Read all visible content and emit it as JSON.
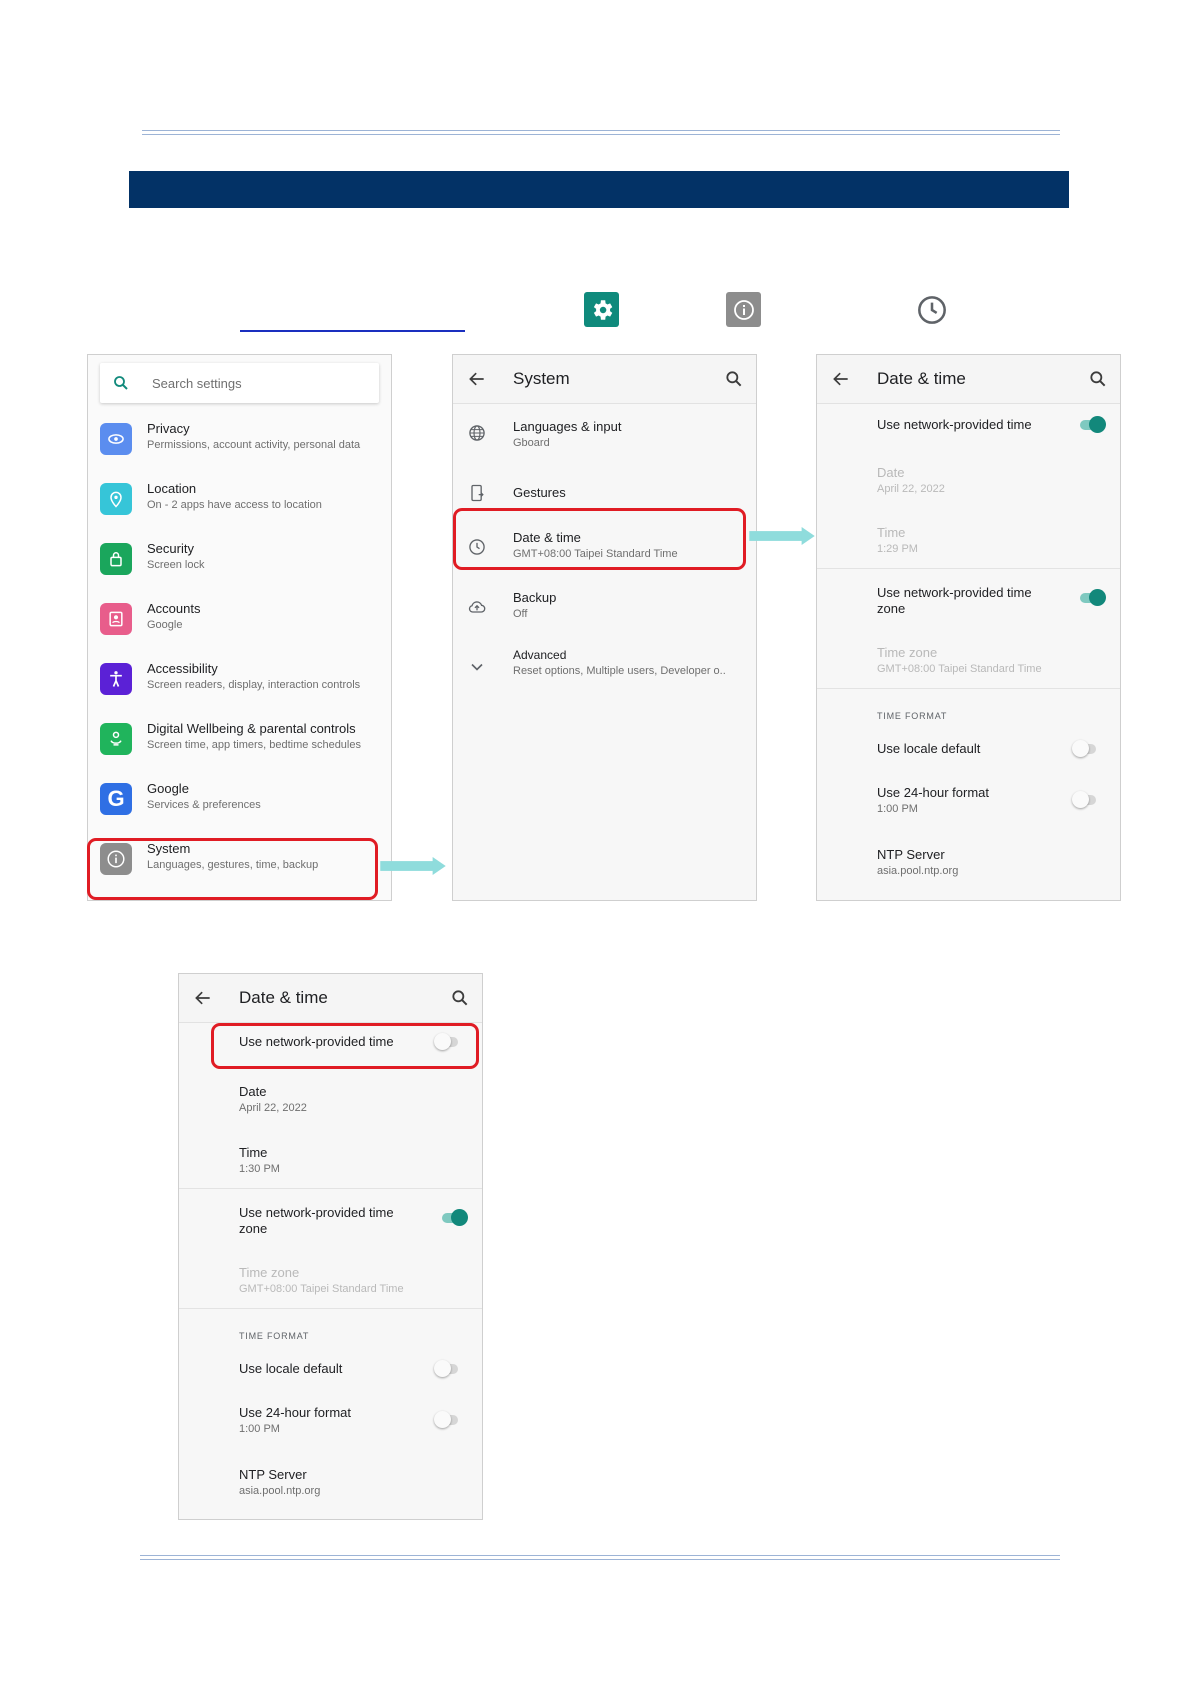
{
  "doc": {
    "banner_color": "#033266",
    "highlight_color": "#e01c24",
    "arrow_color": "#8fdcdc"
  },
  "top_icons": [
    "settings-gear-icon",
    "system-info-icon",
    "clock-icon"
  ],
  "panel1": {
    "search_placeholder": "Search settings",
    "items": [
      {
        "title": "Privacy",
        "subtitle": "Permissions, account activity, personal data",
        "icon": "privacy-icon",
        "color": "#5b8def"
      },
      {
        "title": "Location",
        "subtitle": "On - 2 apps have access to location",
        "icon": "location-pin-icon",
        "color": "#36c5d8"
      },
      {
        "title": "Security",
        "subtitle": "Screen lock",
        "icon": "lock-icon",
        "color": "#1aa65c"
      },
      {
        "title": "Accounts",
        "subtitle": "Google",
        "icon": "account-icon",
        "color": "#e85d8b"
      },
      {
        "title": "Accessibility",
        "subtitle": "Screen readers, display, interaction controls",
        "icon": "accessibility-icon",
        "color": "#5b21d6"
      },
      {
        "title": "Digital Wellbeing & parental controls",
        "subtitle": "Screen time, app timers, bedtime schedules",
        "icon": "wellbeing-icon",
        "color": "#20b45c"
      },
      {
        "title": "Google",
        "subtitle": "Services & preferences",
        "icon": "google-icon",
        "color": "#2f6fe4"
      },
      {
        "title": "System",
        "subtitle": "Languages, gestures, time, backup",
        "icon": "info-icon",
        "color": "#8d8d8d"
      }
    ]
  },
  "panel2": {
    "title": "System",
    "items": [
      {
        "title": "Languages & input",
        "subtitle": "Gboard",
        "icon": "globe-icon"
      },
      {
        "title": "Gestures",
        "subtitle": "",
        "icon": "gestures-icon"
      },
      {
        "title": "Date & time",
        "subtitle": "GMT+08:00 Taipei Standard Time",
        "icon": "clock-icon"
      },
      {
        "title": "Backup",
        "subtitle": "Off",
        "icon": "backup-icon"
      },
      {
        "title": "Advanced",
        "subtitle": "Reset options, Multiple users, Developer o..",
        "icon": "chevron-down-icon"
      }
    ]
  },
  "panel3": {
    "title": "Date & time",
    "auto_time": {
      "label": "Use network-provided time",
      "on": true
    },
    "date": {
      "label": "Date",
      "value": "April 22, 2022"
    },
    "time": {
      "label": "Time",
      "value": "1:29 PM"
    },
    "auto_zone": {
      "label_line1": "Use network-provided time",
      "label_line2": "zone",
      "on": true
    },
    "zone": {
      "label": "Time zone",
      "value": "GMT+08:00 Taipei Standard Time"
    },
    "section": "TIME FORMAT",
    "locale_default": {
      "label": "Use locale default",
      "on": false
    },
    "hour24": {
      "label": "Use 24-hour format",
      "value": "1:00 PM",
      "on": false
    },
    "ntp": {
      "label": "NTP Server",
      "value": "asia.pool.ntp.org"
    }
  },
  "panel4": {
    "title": "Date & time",
    "auto_time": {
      "label": "Use network-provided time",
      "on": false
    },
    "date": {
      "label": "Date",
      "value": "April 22, 2022"
    },
    "time": {
      "label": "Time",
      "value": "1:30 PM"
    },
    "auto_zone": {
      "label_line1": "Use network-provided time",
      "label_line2": "zone",
      "on": true
    },
    "zone": {
      "label": "Time zone",
      "value": "GMT+08:00 Taipei Standard Time"
    },
    "section": "TIME FORMAT",
    "locale_default": {
      "label": "Use locale default",
      "on": false
    },
    "hour24": {
      "label": "Use 24-hour format",
      "value": "1:00 PM",
      "on": false
    },
    "ntp": {
      "label": "NTP Server",
      "value": "asia.pool.ntp.org"
    }
  }
}
